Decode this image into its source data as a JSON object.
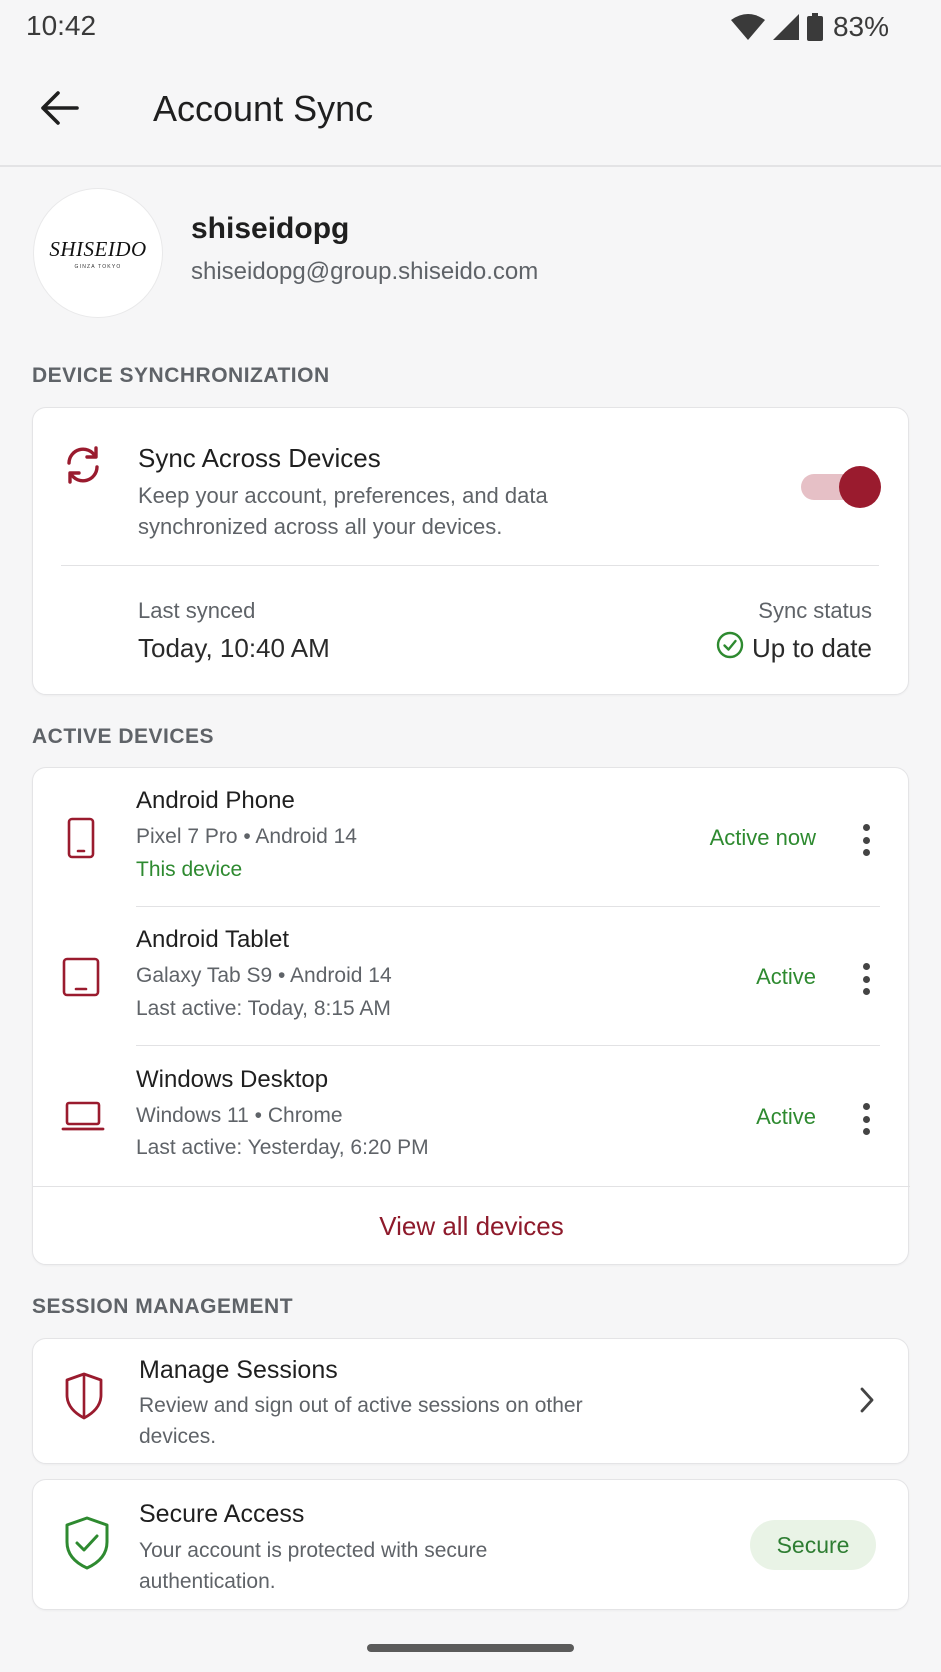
{
  "status_bar": {
    "time": "10:42",
    "battery": "83%"
  },
  "app_bar": {
    "title": "Account Sync",
    "back_icon": "arrow-back-icon"
  },
  "profile": {
    "logo_text": "SHISEIDO",
    "logo_subtext": "GINZA TOKYO",
    "name": "shiseidopg",
    "email": "shiseidopg@group.shiseido.com"
  },
  "sections": {
    "device_sync": "DEVICE SYNCHRONIZATION",
    "active_devices": "ACTIVE DEVICES",
    "session_management": "SESSION MANAGEMENT"
  },
  "sync": {
    "title": "Sync Across Devices",
    "description": "Keep your account, preferences, and data synchronized across all your devices.",
    "enabled": true,
    "last_synced_label": "Last synced",
    "last_synced_value": "Today, 10:40 AM",
    "status_label": "Sync status",
    "status_value": "Up to date"
  },
  "devices": [
    {
      "name": "Android Phone",
      "detail": "Pixel 7 Pro • Android 14",
      "note": "This device",
      "status": "Active now",
      "icon": "phone-icon"
    },
    {
      "name": "Android Tablet",
      "detail": "Galaxy Tab S9 • Android 14",
      "note": "Last active: Today, 8:15 AM",
      "status": "Active",
      "icon": "tablet-icon"
    },
    {
      "name": "Windows Desktop",
      "detail": "Windows 11 • Chrome",
      "note": "Last active: Yesterday, 6:20 PM",
      "status": "Active",
      "icon": "laptop-icon"
    }
  ],
  "view_all": "View all devices",
  "sessions": {
    "title": "Manage Sessions",
    "description": "Review and sign out of active sessions on other devices."
  },
  "secure": {
    "title": "Secure Access",
    "description": "Your account is protected with secure authentication.",
    "badge": "Secure"
  },
  "colors": {
    "accent": "#9a1b2e",
    "toggle_track": "#e6c0c6",
    "active_green": "#2e8a30",
    "secure_badge_bg": "#e9f3e6"
  }
}
